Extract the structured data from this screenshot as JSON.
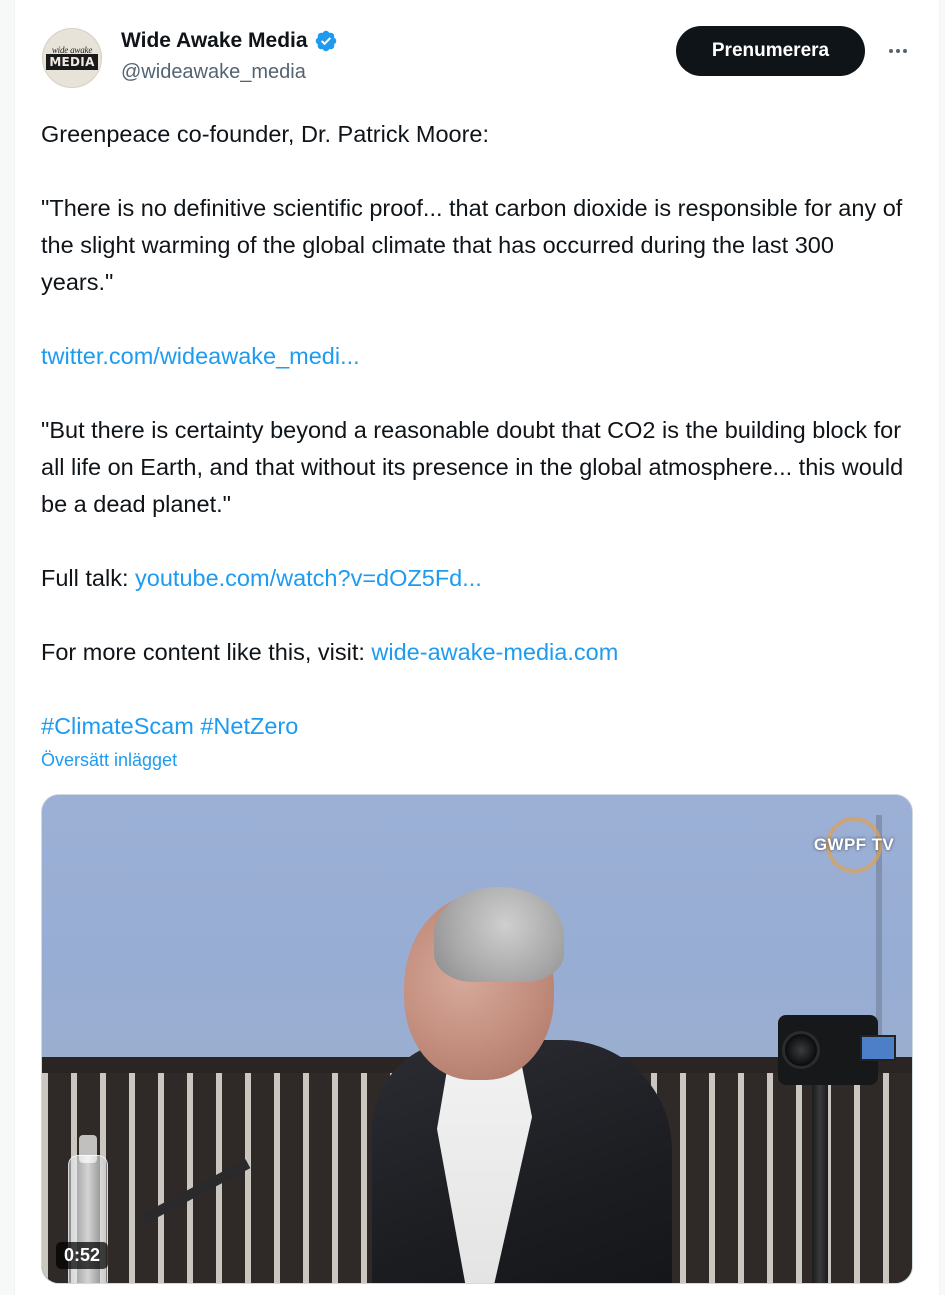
{
  "author": {
    "avatar_small_text": "wide awake",
    "avatar_big_text": "MEDIA",
    "name": "Wide Awake Media",
    "handle": "@wideawake_media",
    "verified_icon": "verified-badge-icon"
  },
  "actions": {
    "subscribe_label": "Prenumerera",
    "more_icon": "more-horizontal-icon"
  },
  "tweet": {
    "intro": "Greenpeace co-founder, Dr. Patrick Moore:",
    "quote1": "\"There is no definitive scientific proof... that carbon dioxide is responsible for any of the slight warming of the global climate that has occurred during the last 300 years.\"",
    "link1": "twitter.com/wideawake_medi...",
    "quote2": "\"But there is certainty beyond a reasonable doubt that CO2 is the building block for all life on Earth, and that without its presence in the global atmosphere... this would be a dead planet.\"",
    "full_talk_prefix": "Full talk: ",
    "full_talk_link": "youtube.com/watch?v=dOZ5Fd...",
    "more_content_prefix": "For more content like this, visit: ",
    "more_content_link": "wide-awake-media.com",
    "hashtag1": "#ClimateScam",
    "hashtag2": "#NetZero",
    "translate_label": "Översätt inlägget"
  },
  "media": {
    "logo_text": "GWPF TV",
    "duration": "0:52"
  },
  "colors": {
    "link": "#1d9bf0",
    "text": "#0f1419",
    "secondary": "#536471",
    "button_bg": "#0f1419"
  }
}
